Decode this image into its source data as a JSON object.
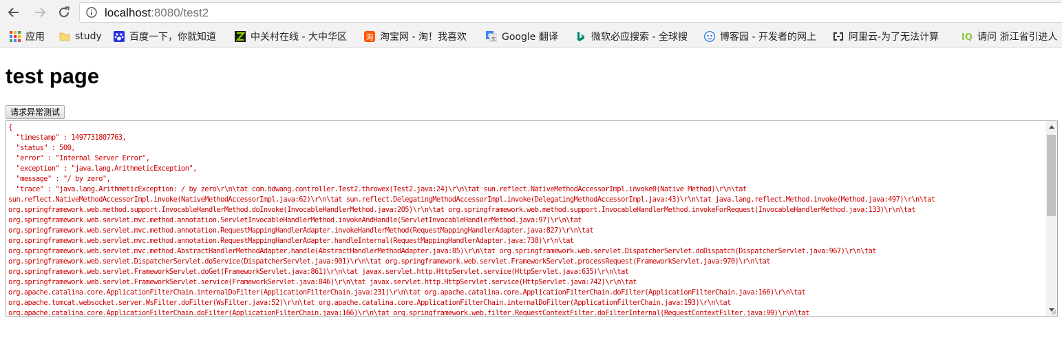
{
  "browser": {
    "url_host": "localhost",
    "url_rest": ":8080/test2"
  },
  "bookmarks": [
    {
      "label": "应用",
      "icon": "apps-grid-icon"
    },
    {
      "label": "study",
      "icon": "folder-icon"
    },
    {
      "label": "百度一下，你就知道",
      "icon": "baidu-paw-icon"
    },
    {
      "label": "中关村在线 - 大中华区",
      "icon": "zol-icon"
    },
    {
      "label": "淘宝网 - 淘！我喜欢",
      "icon": "taobao-icon"
    },
    {
      "label": "Google 翻译",
      "icon": "google-translate-icon"
    },
    {
      "label": "微软必应搜索 - 全球搜",
      "icon": "bing-icon"
    },
    {
      "label": "博客园 - 开发者的网上",
      "icon": "cnblogs-icon"
    },
    {
      "label": "阿里云-为了无法计算",
      "icon": "aliyun-icon"
    },
    {
      "label": "请问 浙江省引进人",
      "icon": "zhihu-icon"
    }
  ],
  "page": {
    "title": "test page",
    "button_label": "请求异常测试",
    "response_text": "{\n  \"timestamp\" : 1497731807763,\n  \"status\" : 500,\n  \"error\" : \"Internal Server Error\",\n  \"exception\" : \"java.lang.ArithmeticException\",\n  \"message\" : \"/ by zero\",\n  \"trace\" : \"java.lang.ArithmeticException: / by zero\\r\\n\\tat com.hdwang.controller.Test2.throwex(Test2.java:24)\\r\\n\\tat sun.reflect.NativeMethodAccessorImpl.invoke0(Native Method)\\r\\n\\tat\nsun.reflect.NativeMethodAccessorImpl.invoke(NativeMethodAccessorImpl.java:62)\\r\\n\\tat sun.reflect.DelegatingMethodAccessorImpl.invoke(DelegatingMethodAccessorImpl.java:43)\\r\\n\\tat java.lang.reflect.Method.invoke(Method.java:497)\\r\\n\\tat\norg.springframework.web.method.support.InvocableHandlerMethod.doInvoke(InvocableHandlerMethod.java:205)\\r\\n\\tat org.springframework.web.method.support.InvocableHandlerMethod.invokeForRequest(InvocableHandlerMethod.java:133)\\r\\n\\tat\norg.springframework.web.servlet.mvc.method.annotation.ServletInvocableHandlerMethod.invokeAndHandle(ServletInvocableHandlerMethod.java:97)\\r\\n\\tat\norg.springframework.web.servlet.mvc.method.annotation.RequestMappingHandlerAdapter.invokeHandlerMethod(RequestMappingHandlerAdapter.java:827)\\r\\n\\tat\norg.springframework.web.servlet.mvc.method.annotation.RequestMappingHandlerAdapter.handleInternal(RequestMappingHandlerAdapter.java:738)\\r\\n\\tat\norg.springframework.web.servlet.mvc.method.AbstractHandlerMethodAdapter.handle(AbstractHandlerMethodAdapter.java:85)\\r\\n\\tat org.springframework.web.servlet.DispatcherServlet.doDispatch(DispatcherServlet.java:967)\\r\\n\\tat\norg.springframework.web.servlet.DispatcherServlet.doService(DispatcherServlet.java:901)\\r\\n\\tat org.springframework.web.servlet.FrameworkServlet.processRequest(FrameworkServlet.java:970)\\r\\n\\tat\norg.springframework.web.servlet.FrameworkServlet.doGet(FrameworkServlet.java:861)\\r\\n\\tat javax.servlet.http.HttpServlet.service(HttpServlet.java:635)\\r\\n\\tat\norg.springframework.web.servlet.FrameworkServlet.service(FrameworkServlet.java:846)\\r\\n\\tat javax.servlet.http.HttpServlet.service(HttpServlet.java:742)\\r\\n\\tat\norg.apache.catalina.core.ApplicationFilterChain.internalDoFilter(ApplicationFilterChain.java:231)\\r\\n\\tat org.apache.catalina.core.ApplicationFilterChain.doFilter(ApplicationFilterChain.java:166)\\r\\n\\tat\norg.apache.tomcat.websocket.server.WsFilter.doFilter(WsFilter.java:52)\\r\\n\\tat org.apache.catalina.core.ApplicationFilterChain.internalDoFilter(ApplicationFilterChain.java:193)\\r\\n\\tat\norg.apache.catalina.core.ApplicationFilterChain.doFilter(ApplicationFilterChain.java:166)\\r\\n\\tat org.springframework.web.filter.RequestContextFilter.doFilterInternal(RequestContextFilter.java:99)\\r\\n\\tat"
  },
  "colors": {
    "response_text": "#cc0000",
    "toolbar_bg": "#f2f2f2"
  }
}
